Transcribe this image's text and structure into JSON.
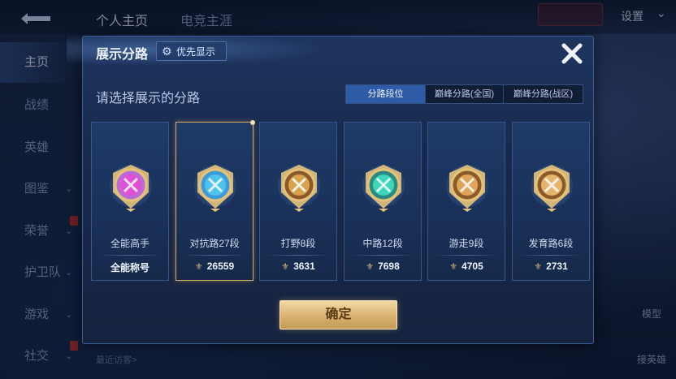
{
  "topbar": {
    "tabs": [
      {
        "label": "个人主页"
      },
      {
        "label": "电竞主涯"
      }
    ],
    "settings_label": "设置"
  },
  "sidenav": {
    "items": [
      {
        "label": "主页",
        "active": true
      },
      {
        "label": "战绩"
      },
      {
        "label": "英雄"
      },
      {
        "label": "图鉴"
      },
      {
        "label": "荣誉"
      },
      {
        "label": "护卫队"
      },
      {
        "label": "游戏"
      },
      {
        "label": "社交"
      }
    ]
  },
  "background": {
    "recent_visit": "最近访客>",
    "right_labels": [
      {
        "label": "模型"
      },
      {
        "label": "接英雄"
      }
    ]
  },
  "modal": {
    "title": "展示分路",
    "priority_label": "优先显示",
    "prompt": "请选择展示的分路",
    "segments": [
      {
        "label": "分路段位",
        "active": true
      },
      {
        "label": "巅峰分路(全国)"
      },
      {
        "label": "巅峰分路(战区)"
      }
    ],
    "cards": [
      {
        "name": "全能高手",
        "stat": "全能称号",
        "show_icon": false,
        "colors": {
          "ring": "#b86bd6",
          "inner": "#e04fd4",
          "rim": "#e4c27a"
        },
        "icon": "all-round-emblem-icon"
      },
      {
        "name": "对抗路27段",
        "stat": "26559",
        "show_icon": true,
        "selected": true,
        "colors": {
          "ring": "#3d9ad8",
          "inner": "#4ec2f0",
          "rim": "#e4c27a"
        },
        "icon": "clash-lane-emblem-icon"
      },
      {
        "name": "打野8段",
        "stat": "3631",
        "show_icon": true,
        "colors": {
          "ring": "#8a5a2a",
          "inner": "#d9a24e",
          "rim": "#e4c27a"
        },
        "icon": "jungle-emblem-icon"
      },
      {
        "name": "中路12段",
        "stat": "7698",
        "show_icon": true,
        "colors": {
          "ring": "#2a8a80",
          "inner": "#3ed6b8",
          "rim": "#e4c27a"
        },
        "icon": "mid-lane-emblem-icon"
      },
      {
        "name": "游走9段",
        "stat": "4705",
        "show_icon": true,
        "colors": {
          "ring": "#8a5a2a",
          "inner": "#e0a35a",
          "rim": "#e4c27a"
        },
        "icon": "roam-emblem-icon"
      },
      {
        "name": "发育路6段",
        "stat": "2731",
        "show_icon": true,
        "colors": {
          "ring": "#8a5a2a",
          "inner": "#e6b46a",
          "rim": "#e4c27a"
        },
        "icon": "farm-lane-emblem-icon"
      }
    ],
    "confirm_label": "确定"
  }
}
